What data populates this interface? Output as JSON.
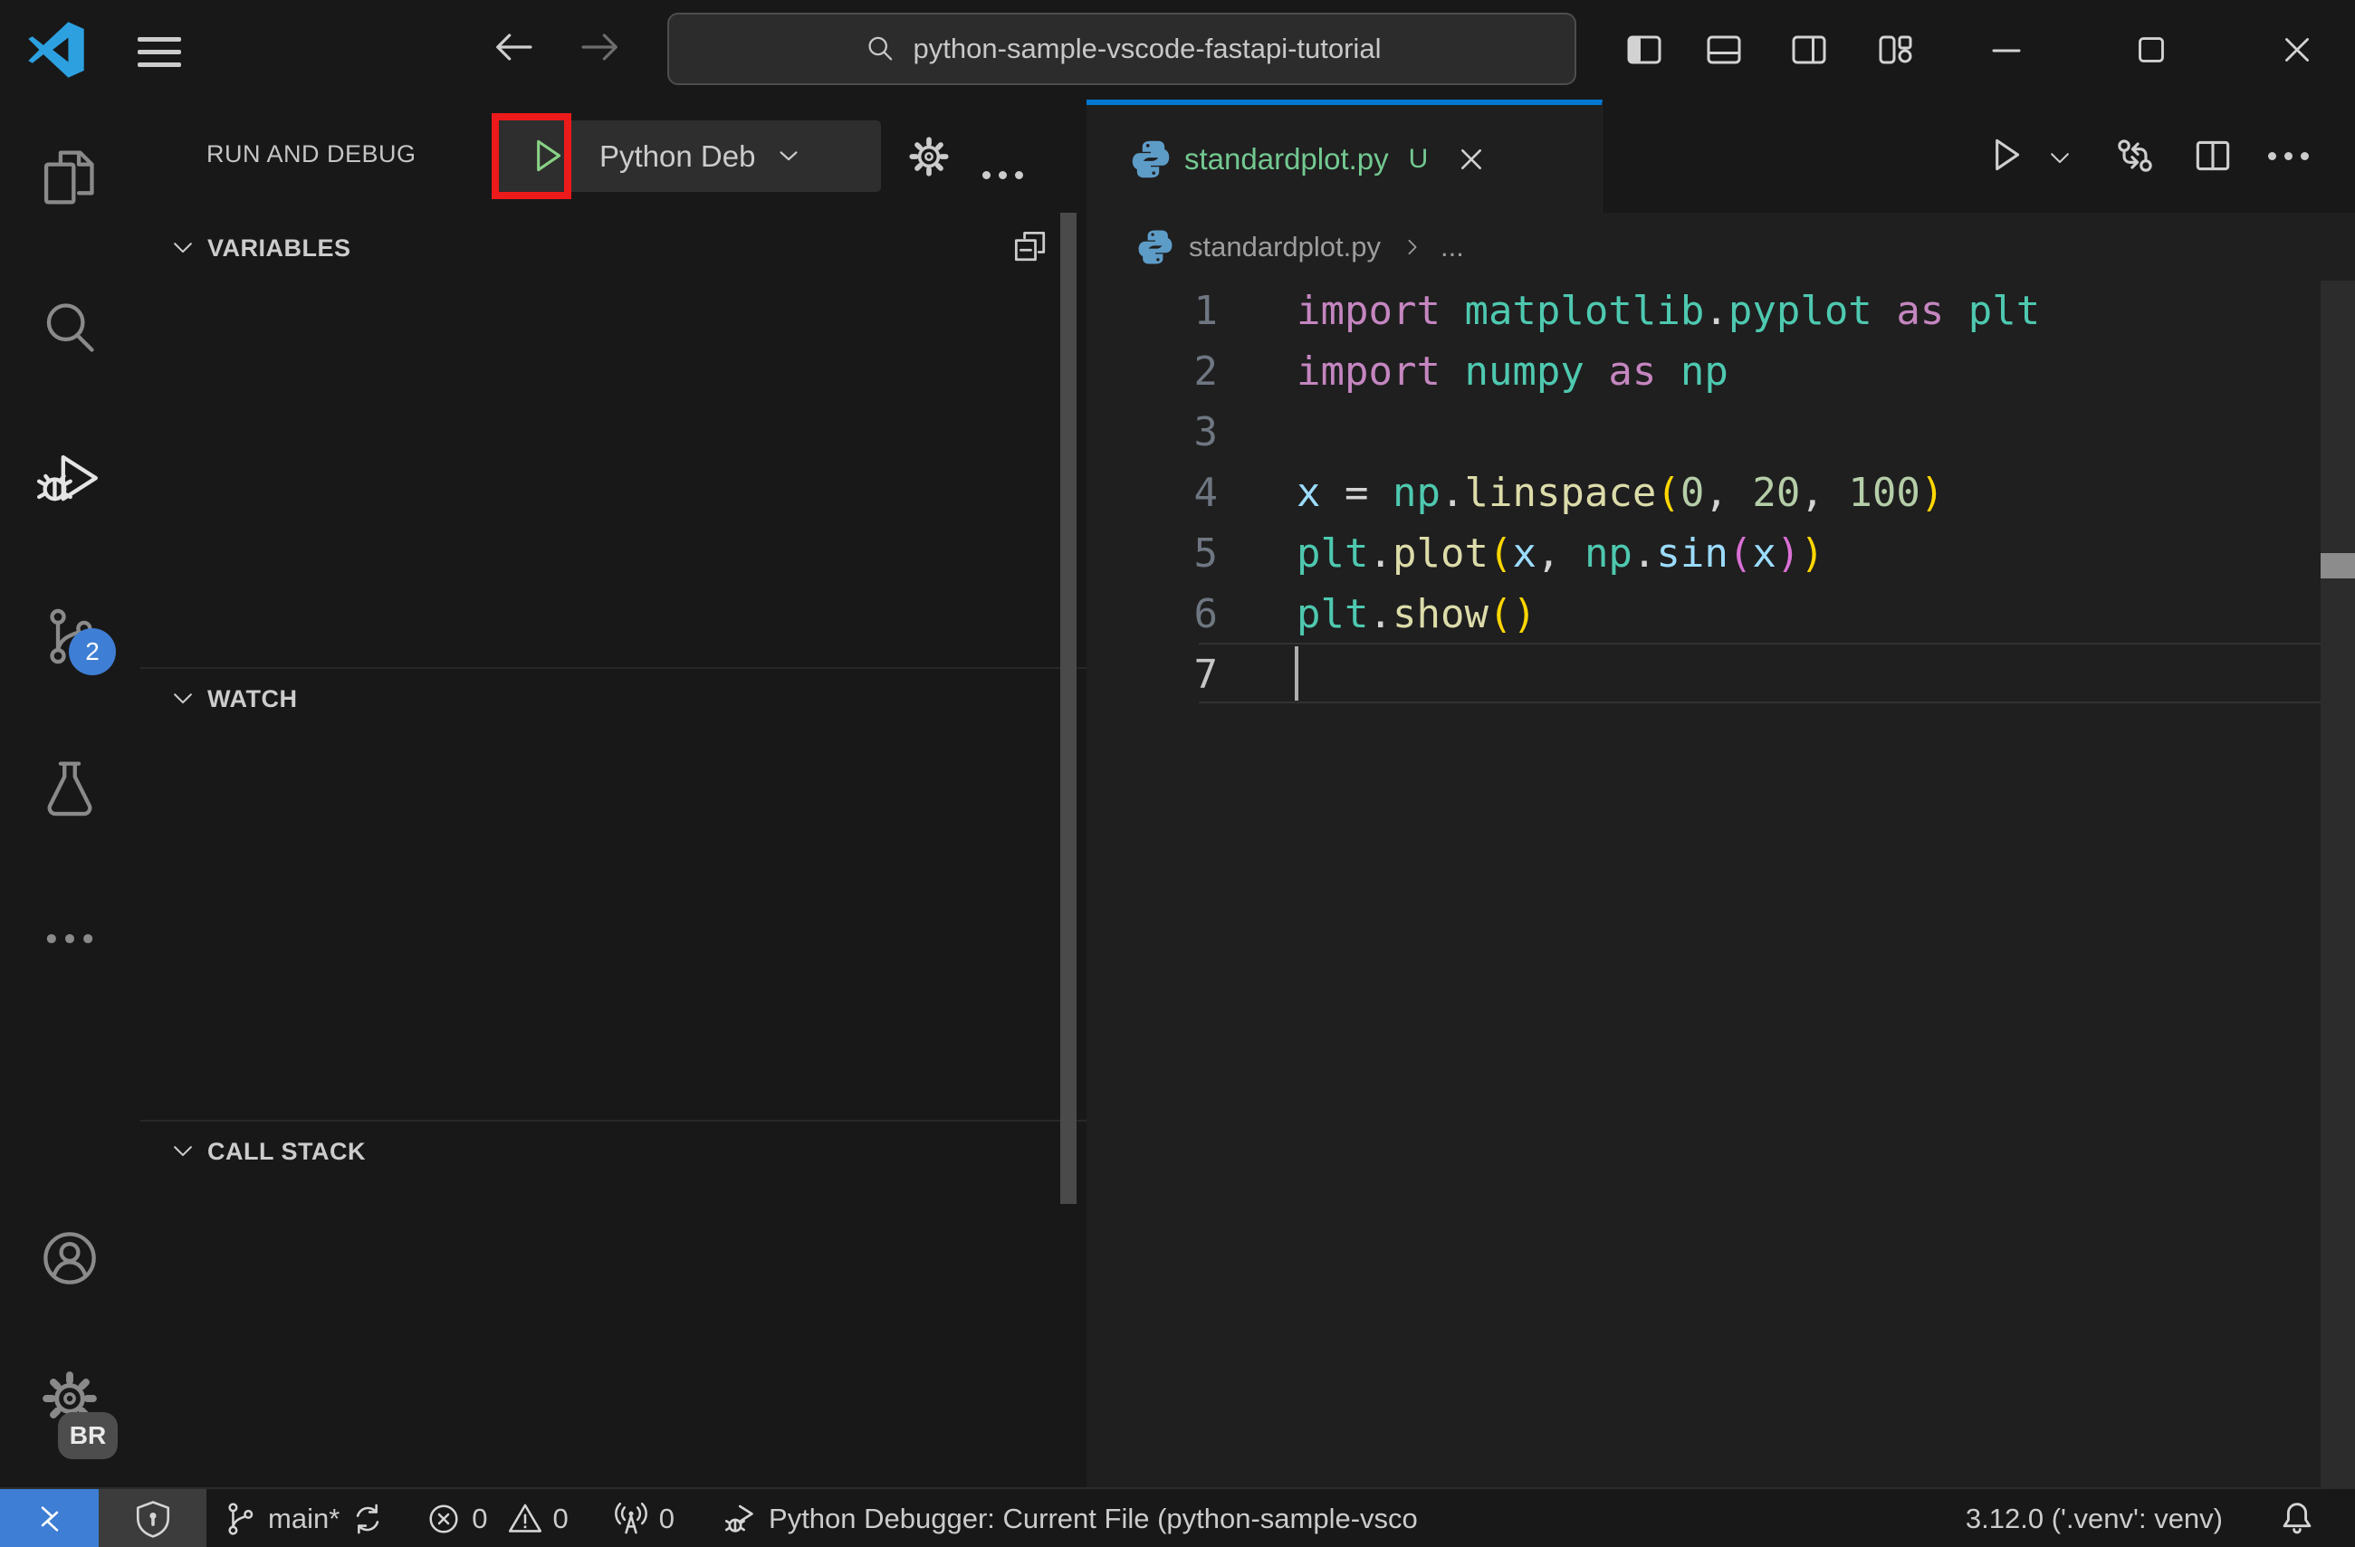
{
  "title_bar": {
    "search_value": "python-sample-vscode-fastapi-tutorial"
  },
  "activity_bar": {
    "scm_badge": "2",
    "profile_badge": "BR"
  },
  "sidebar": {
    "title": "RUN AND DEBUG",
    "debug_config_label": "Python Deb",
    "sections": [
      {
        "label": "VARIABLES"
      },
      {
        "label": "WATCH"
      },
      {
        "label": "CALL STACK"
      }
    ]
  },
  "editor": {
    "tab": {
      "filename": "standardplot.py",
      "dirty_badge": "U"
    },
    "breadcrumb": {
      "file": "standardplot.py",
      "symbol": "..."
    },
    "code": {
      "active_line": 7,
      "lines": [
        [
          [
            "kw",
            "import"
          ],
          [
            "op",
            " "
          ],
          [
            "mod",
            "matplotlib"
          ],
          [
            "op",
            "."
          ],
          [
            "mod",
            "pyplot"
          ],
          [
            "op",
            " "
          ],
          [
            "kw",
            "as"
          ],
          [
            "op",
            " "
          ],
          [
            "mod",
            "plt"
          ]
        ],
        [
          [
            "kw",
            "import"
          ],
          [
            "op",
            " "
          ],
          [
            "mod",
            "numpy"
          ],
          [
            "op",
            " "
          ],
          [
            "kw",
            "as"
          ],
          [
            "op",
            " "
          ],
          [
            "mod",
            "np"
          ]
        ],
        [],
        [
          [
            "var",
            "x"
          ],
          [
            "op",
            " = "
          ],
          [
            "mod",
            "np"
          ],
          [
            "op",
            "."
          ],
          [
            "fn",
            "linspace"
          ],
          [
            "b1",
            "("
          ],
          [
            "num",
            "0"
          ],
          [
            "op",
            ", "
          ],
          [
            "num",
            "20"
          ],
          [
            "op",
            ", "
          ],
          [
            "num",
            "100"
          ],
          [
            "b1",
            ")"
          ]
        ],
        [
          [
            "mod",
            "plt"
          ],
          [
            "op",
            "."
          ],
          [
            "fn",
            "plot"
          ],
          [
            "b1",
            "("
          ],
          [
            "var",
            "x"
          ],
          [
            "op",
            ", "
          ],
          [
            "mod",
            "np"
          ],
          [
            "op",
            "."
          ],
          [
            "var",
            "sin"
          ],
          [
            "b2",
            "("
          ],
          [
            "var",
            "x"
          ],
          [
            "b2",
            ")"
          ],
          [
            "b1",
            ")"
          ]
        ],
        [
          [
            "mod",
            "plt"
          ],
          [
            "op",
            "."
          ],
          [
            "fn",
            "show"
          ],
          [
            "b1",
            "("
          ],
          [
            "b1",
            ")"
          ]
        ],
        []
      ]
    }
  },
  "status_bar": {
    "branch_label": "main*",
    "errors_count": "0",
    "warnings_count": "0",
    "ports_count": "0",
    "debug_label": "Python Debugger: Current File (python-sample-vsco",
    "python_version": "3.12.0 ('.venv': venv)"
  },
  "annotation": {
    "highlight_box_color": "#ec1a1a",
    "highlight_target": "start-debugging-button"
  },
  "colors": {
    "accent_blue": "#0078d4",
    "remote_indicator_bg": "#3e7ed4",
    "untracked_file_green": "#73c991",
    "debug_play_green": "#89d185"
  }
}
